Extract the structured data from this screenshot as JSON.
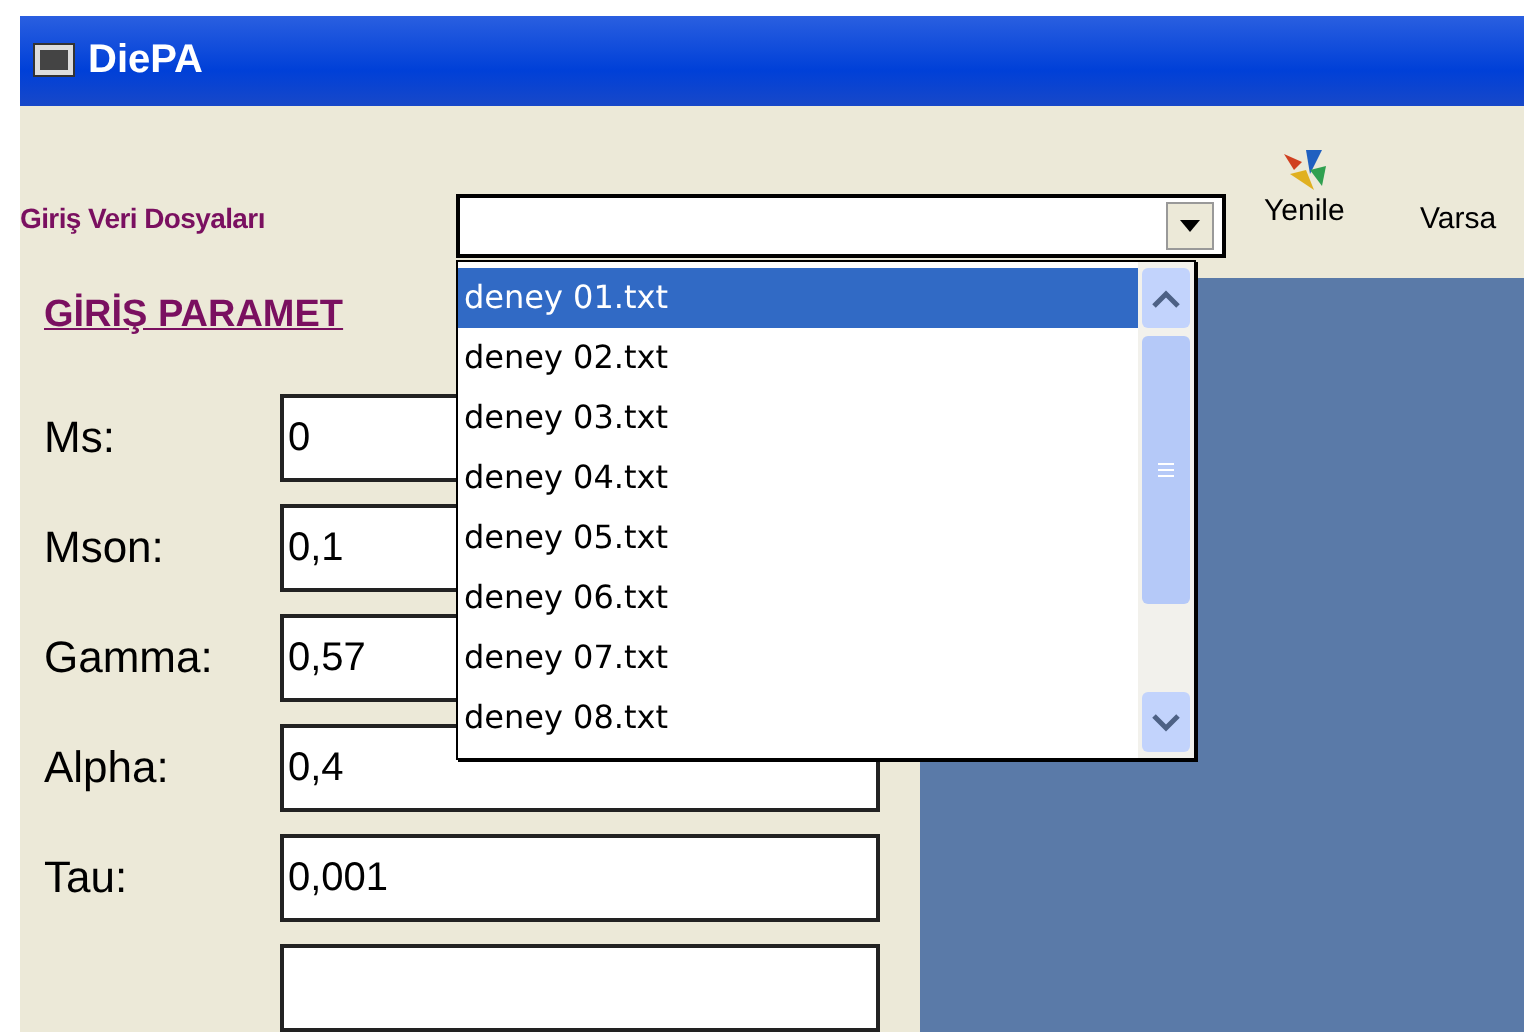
{
  "window": {
    "title": "DiePA"
  },
  "toolbar": {
    "combo_label": "Giriş Veri Dosyaları",
    "buttons": [
      {
        "label": "Yenile",
        "kind": "icon"
      },
      {
        "label": "Varsa",
        "kind": "text"
      }
    ]
  },
  "dropdown": {
    "items": [
      {
        "label": "deney 01.txt",
        "selected": true
      },
      {
        "label": "deney 02.txt",
        "selected": false
      },
      {
        "label": "deney 03.txt",
        "selected": false
      },
      {
        "label": "deney 04.txt",
        "selected": false
      },
      {
        "label": "deney 05.txt",
        "selected": false
      },
      {
        "label": "deney 06.txt",
        "selected": false
      },
      {
        "label": "deney 07.txt",
        "selected": false
      },
      {
        "label": "deney 08.txt",
        "selected": false
      }
    ]
  },
  "parameters": {
    "heading": "GİRİŞ PARAMET",
    "fields": [
      {
        "label": "Ms:",
        "value": "0"
      },
      {
        "label": "Mson:",
        "value": "0,1"
      },
      {
        "label": "Gamma:",
        "value": "0,57"
      },
      {
        "label": "Alpha:",
        "value": "0,4"
      },
      {
        "label": "Tau:",
        "value": "0,001"
      }
    ]
  }
}
